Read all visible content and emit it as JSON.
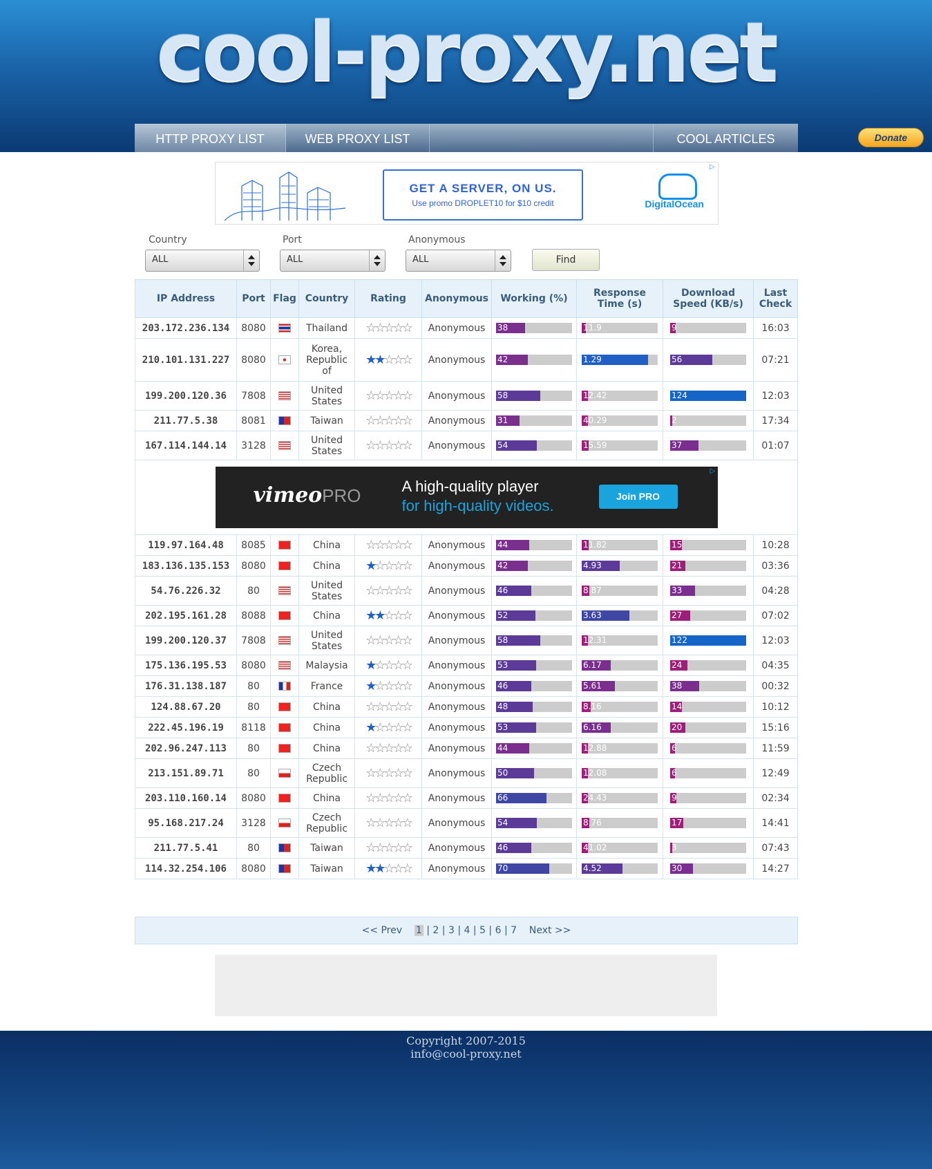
{
  "site": {
    "logo": "cool-proxy.net"
  },
  "nav": {
    "items": [
      "HTTP PROXY LIST",
      "WEB PROXY LIST",
      "COOL ARTICLES"
    ],
    "donate": "Donate"
  },
  "ad_top": {
    "headline": "GET A SERVER, ON US.",
    "sub": "Use promo DROPLET10 for $10 credit",
    "brand": "DigitalOcean"
  },
  "filters": {
    "country_label": "Country",
    "country_value": "ALL",
    "port_label": "Port",
    "port_value": "ALL",
    "anon_label": "Anonymous",
    "anon_value": "ALL",
    "find_label": "Find"
  },
  "table": {
    "headers": [
      "IP Address",
      "Port",
      "Flag",
      "Country",
      "Rating",
      "Anonymous",
      "Working (%)",
      "Response Time (s)",
      "Download Speed (KB/s)",
      "Last Check"
    ],
    "rows": [
      {
        "ip": "203.172.236.134",
        "port": "8080",
        "country": "Thailand",
        "rating": 0,
        "anon": "Anonymous",
        "working": 38,
        "resp": "11.9",
        "resp_frac": 0.05,
        "speed": "9",
        "speed_frac": 0.07,
        "check": "16:03",
        "flag": "th"
      },
      {
        "ip": "210.101.131.227",
        "port": "8080",
        "country": "Korea, Republic of",
        "rating": 2,
        "anon": "Anonymous",
        "working": 42,
        "resp": "1.29",
        "resp_frac": 0.87,
        "speed": "56",
        "speed_frac": 0.55,
        "check": "07:21",
        "flag": "kr"
      },
      {
        "ip": "199.200.120.36",
        "port": "7808",
        "country": "United States",
        "rating": 0,
        "anon": "Anonymous",
        "working": 58,
        "resp": "12.42",
        "resp_frac": 0.08,
        "speed": "124",
        "speed_frac": 1.0,
        "check": "12:03",
        "flag": "us"
      },
      {
        "ip": "211.77.5.38",
        "port": "8081",
        "country": "Taiwan",
        "rating": 0,
        "anon": "Anonymous",
        "working": 31,
        "resp": "40.29",
        "resp_frac": 0.08,
        "speed": "2",
        "speed_frac": 0.02,
        "check": "17:34",
        "flag": "tw"
      },
      {
        "ip": "167.114.144.14",
        "port": "3128",
        "country": "United States",
        "rating": 0,
        "anon": "Anonymous",
        "working": 54,
        "resp": "15.59",
        "resp_frac": 0.09,
        "speed": "37",
        "speed_frac": 0.37,
        "check": "01:07",
        "flag": "us"
      },
      {
        "ad": true
      },
      {
        "ip": "119.97.164.48",
        "port": "8085",
        "country": "China",
        "rating": 0,
        "anon": "Anonymous",
        "working": 44,
        "resp": "11.82",
        "resp_frac": 0.09,
        "speed": "15",
        "speed_frac": 0.15,
        "check": "10:28",
        "flag": "cn"
      },
      {
        "ip": "183.136.135.153",
        "port": "8080",
        "country": "China",
        "rating": 1,
        "anon": "Anonymous",
        "working": 42,
        "resp": "4.93",
        "resp_frac": 0.5,
        "speed": "21",
        "speed_frac": 0.2,
        "check": "03:36",
        "flag": "cn"
      },
      {
        "ip": "54.76.226.32",
        "port": "80",
        "country": "United States",
        "rating": 0,
        "anon": "Anonymous",
        "working": 46,
        "resp": "8.87",
        "resp_frac": 0.1,
        "speed": "33",
        "speed_frac": 0.33,
        "check": "04:28",
        "flag": "us"
      },
      {
        "ip": "202.195.161.28",
        "port": "8088",
        "country": "China",
        "rating": 2,
        "anon": "Anonymous",
        "working": 52,
        "resp": "3.63",
        "resp_frac": 0.63,
        "speed": "27",
        "speed_frac": 0.26,
        "check": "07:02",
        "flag": "cn"
      },
      {
        "ip": "199.200.120.37",
        "port": "7808",
        "country": "United States",
        "rating": 0,
        "anon": "Anonymous",
        "working": 58,
        "resp": "12.31",
        "resp_frac": 0.08,
        "speed": "122",
        "speed_frac": 1.0,
        "check": "12:03",
        "flag": "us"
      },
      {
        "ip": "175.136.195.53",
        "port": "8080",
        "country": "Malaysia",
        "rating": 1,
        "anon": "Anonymous",
        "working": 53,
        "resp": "6.17",
        "resp_frac": 0.38,
        "speed": "24",
        "speed_frac": 0.23,
        "check": "04:35",
        "flag": "my"
      },
      {
        "ip": "176.31.138.187",
        "port": "80",
        "country": "France",
        "rating": 1,
        "anon": "Anonymous",
        "working": 46,
        "resp": "5.61",
        "resp_frac": 0.44,
        "speed": "38",
        "speed_frac": 0.38,
        "check": "00:32",
        "flag": "fr"
      },
      {
        "ip": "124.88.67.20",
        "port": "80",
        "country": "China",
        "rating": 0,
        "anon": "Anonymous",
        "working": 48,
        "resp": "8.16",
        "resp_frac": 0.12,
        "speed": "14",
        "speed_frac": 0.15,
        "check": "10:12",
        "flag": "cn"
      },
      {
        "ip": "222.45.196.19",
        "port": "8118",
        "country": "China",
        "rating": 1,
        "anon": "Anonymous",
        "working": 53,
        "resp": "6.16",
        "resp_frac": 0.38,
        "speed": "20",
        "speed_frac": 0.2,
        "check": "15:16",
        "flag": "cn"
      },
      {
        "ip": "202.96.247.113",
        "port": "80",
        "country": "China",
        "rating": 0,
        "anon": "Anonymous",
        "working": 44,
        "resp": "12.88",
        "resp_frac": 0.08,
        "speed": "6",
        "speed_frac": 0.06,
        "check": "11:59",
        "flag": "cn"
      },
      {
        "ip": "213.151.89.71",
        "port": "80",
        "country": "Czech Republic",
        "rating": 0,
        "anon": "Anonymous",
        "working": 50,
        "resp": "12.08",
        "resp_frac": 0.08,
        "speed": "6",
        "speed_frac": 0.06,
        "check": "12:49",
        "flag": "cz"
      },
      {
        "ip": "203.110.160.14",
        "port": "8080",
        "country": "China",
        "rating": 0,
        "anon": "Anonymous",
        "working": 66,
        "resp": "24.43",
        "resp_frac": 0.08,
        "speed": "9",
        "speed_frac": 0.08,
        "check": "02:34",
        "flag": "cn"
      },
      {
        "ip": "95.168.217.24",
        "port": "3128",
        "country": "Czech Republic",
        "rating": 0,
        "anon": "Anonymous",
        "working": 54,
        "resp": "8.76",
        "resp_frac": 0.1,
        "speed": "17",
        "speed_frac": 0.17,
        "check": "14:41",
        "flag": "cz"
      },
      {
        "ip": "211.77.5.41",
        "port": "80",
        "country": "Taiwan",
        "rating": 0,
        "anon": "Anonymous",
        "working": 46,
        "resp": "41.02",
        "resp_frac": 0.08,
        "speed": "3",
        "speed_frac": 0.03,
        "check": "07:43",
        "flag": "tw"
      },
      {
        "ip": "114.32.254.106",
        "port": "8080",
        "country": "Taiwan",
        "rating": 2,
        "anon": "Anonymous",
        "working": 70,
        "resp": "4.52",
        "resp_frac": 0.54,
        "speed": "30",
        "speed_frac": 0.3,
        "check": "14:27",
        "flag": "tw"
      }
    ]
  },
  "ad_mid": {
    "brand": "vimeo",
    "brand_suffix": "PRO",
    "line1": "A high-quality player",
    "line2": "for high-quality videos.",
    "button": "Join PRO"
  },
  "pager": {
    "prev": "<< Prev",
    "pages": [
      "1",
      "2",
      "3",
      "4",
      "5",
      "6",
      "7"
    ],
    "current": "1",
    "next": "Next >>"
  },
  "footer": {
    "copyright": "Copyright 2007-2015",
    "email": "info@cool-proxy.net"
  }
}
